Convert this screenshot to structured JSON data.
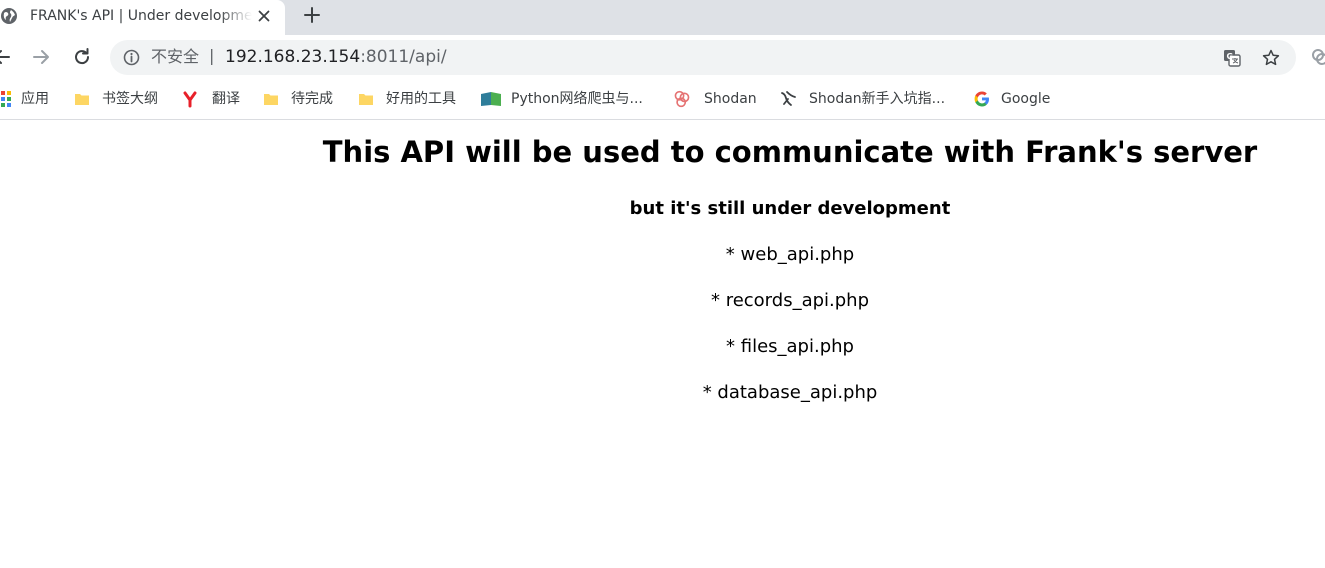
{
  "tab": {
    "title": "FRANK's API | Under development",
    "favicon": "globe-icon",
    "close": "close-icon"
  },
  "toolbar": {
    "back": "back-arrow-icon",
    "forward": "forward-arrow-icon",
    "reload": "reload-icon",
    "security_label": "不安全",
    "url_separator": "|",
    "url_host": "192.168.23.154",
    "url_rest": ":8011/api/"
  },
  "bookmarks": [
    {
      "label": "应用",
      "icon": "apps-grid-icon"
    },
    {
      "label": "书签大纲",
      "icon": "folder-icon"
    },
    {
      "label": "翻译",
      "icon": "youdao-icon"
    },
    {
      "label": "待完成",
      "icon": "folder-icon"
    },
    {
      "label": "好用的工具",
      "icon": "folder-icon"
    },
    {
      "label": "Python网络爬虫与...",
      "icon": "book-icon"
    },
    {
      "label": "Shodan",
      "icon": "shodan-icon"
    },
    {
      "label": "Shodan新手入坑指...",
      "icon": "shodan-guide-icon"
    },
    {
      "label": "Google",
      "icon": "google-icon"
    }
  ],
  "page": {
    "title": "This API will be used to communicate with Frank's server",
    "subtitle": "but it's still under development",
    "items": [
      "* web_api.php",
      "* records_api.php",
      "* files_api.php",
      "* database_api.php"
    ]
  },
  "colors": {
    "tabstrip": "#dee1e6",
    "omnibox": "#f1f3f4",
    "folder": "#fdd663",
    "youdao": "#e8202a"
  }
}
